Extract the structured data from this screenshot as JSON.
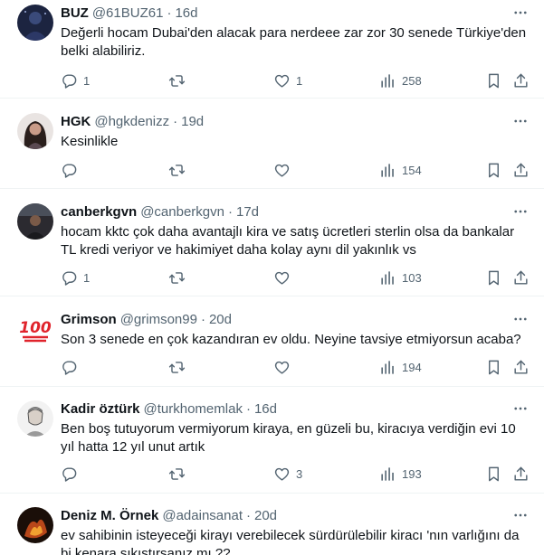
{
  "tweets": [
    {
      "name": "BUZ",
      "handle": "@61BUZ61",
      "sep": "·",
      "time": "16d",
      "text": "Değerli hocam Dubai'den alacak para nerdeee zar zor 30 senede Türkiye'den belki alabiliriz.",
      "replies": "1",
      "retweets": "",
      "likes": "1",
      "views": "258",
      "avatar": "night-sky-avatar"
    },
    {
      "name": "HGK",
      "handle": "@hgkdenizz",
      "sep": "·",
      "time": "19d",
      "text": "Kesinlikle",
      "replies": "",
      "retweets": "",
      "likes": "",
      "views": "154",
      "avatar": "woman-portrait-avatar"
    },
    {
      "name": "canberkgvn",
      "handle": "@canberkgvn",
      "sep": "·",
      "time": "17d",
      "text": "hocam kktc çok daha avantajlı kira ve satış ücretleri sterlin olsa da bankalar TL kredi veriyor ve hakimiyet daha kolay aynı dil yakınlık vs",
      "replies": "1",
      "retweets": "",
      "likes": "",
      "views": "103",
      "avatar": "dark-photo-avatar"
    },
    {
      "name": "Grimson",
      "handle": "@grimson99",
      "sep": "·",
      "time": "20d",
      "text": "Son 3 senede en çok kazandıran ev oldu. Neyine tavsiye etmiyorsun acaba?",
      "replies": "",
      "retweets": "",
      "likes": "",
      "views": "194",
      "avatar": "hundred-points-emoji-avatar"
    },
    {
      "name": "Kadir öztürk",
      "handle": "@turkhomemlak",
      "sep": "·",
      "time": "16d",
      "text": "Ben boş tutuyorum vermiyorum kiraya, en güzeli bu, kiracıya verdiğin evi 10 yıl hatta 12 yıl unut artık",
      "replies": "",
      "retweets": "",
      "likes": "3",
      "views": "193",
      "avatar": "sketch-portrait-avatar"
    },
    {
      "name": "Deniz M. Örnek",
      "handle": "@adainsanat",
      "sep": "·",
      "time": "20d",
      "text": "ev sahibinin isteyeceği kirayı verebilecek sürdürülebilir  kiracı 'nın varlığını da bi kenara sıkıştırsanız mı ??",
      "replies": "",
      "retweets": "",
      "likes": "",
      "views": "",
      "avatar": "fire-art-avatar"
    }
  ],
  "icons": {
    "reply": "reply-icon",
    "retweet": "retweet-icon",
    "like": "heart-icon",
    "views": "views-icon",
    "bookmark": "bookmark-icon",
    "share": "share-icon",
    "more": "more-icon"
  },
  "colors": {
    "text": "#0f1419",
    "secondary": "#536471",
    "divider": "#eff3f4"
  }
}
